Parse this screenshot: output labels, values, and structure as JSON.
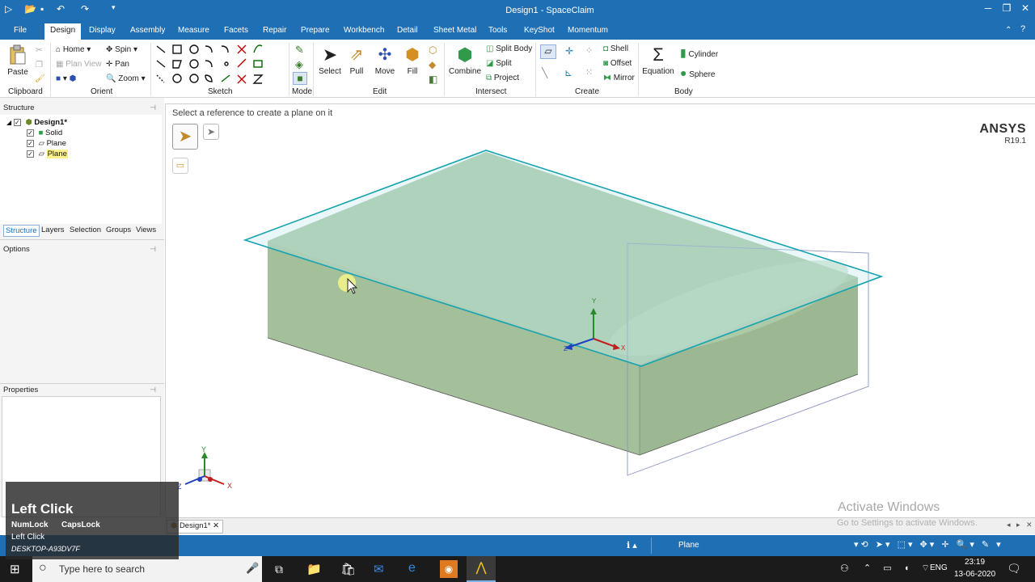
{
  "window": {
    "title": "Design1 - SpaceClaim"
  },
  "tabs": [
    "File",
    "Design",
    "Display",
    "Assembly",
    "Measure",
    "Facets",
    "Repair",
    "Prepare",
    "Workbench",
    "Detail",
    "Sheet Metal",
    "Tools",
    "KeyShot",
    "Momentum"
  ],
  "ribbon": {
    "groups": [
      "Clipboard",
      "Orient",
      "Sketch",
      "Mode",
      "Edit",
      "Intersect",
      "Create",
      "Body"
    ],
    "clipboard": {
      "paste": "Paste"
    },
    "orient": {
      "home": "Home",
      "spin": "Spin",
      "plan_view": "Plan View",
      "pan": "Pan",
      "zoom": "Zoom"
    },
    "edit": {
      "select": "Select",
      "pull": "Pull",
      "move": "Move",
      "fill": "Fill"
    },
    "intersect": {
      "combine": "Combine",
      "split_body": "Split Body",
      "split": "Split",
      "project": "Project"
    },
    "create": {
      "shell": "Shell",
      "offset": "Offset",
      "mirror": "Mirror"
    },
    "body": {
      "equation": "Equation",
      "cylinder": "Cylinder",
      "sphere": "Sphere"
    }
  },
  "structure": {
    "title": "Structure",
    "tree": [
      {
        "label": "Design1*"
      },
      {
        "label": "Solid"
      },
      {
        "label": "Plane"
      },
      {
        "label": "Plane"
      }
    ]
  },
  "panel_tabs": [
    "Structure",
    "Layers",
    "Selection",
    "Groups",
    "Views"
  ],
  "options": {
    "title": "Options"
  },
  "properties": {
    "title": "Properties"
  },
  "viewport": {
    "hint": "Select a reference to create a plane on it",
    "brand": "ANSYS",
    "version": "R19.1",
    "axis_x": "X",
    "axis_y": "Y",
    "axis_z": "Z",
    "watermark_title": "Activate Windows",
    "watermark_sub": "Go to Settings to activate Windows."
  },
  "doc_tab": {
    "label": "Design1*"
  },
  "status": {
    "selection": "Plane"
  },
  "overlay": {
    "action": "Left Click",
    "numlock": "NumLock",
    "capslock": "CapsLock",
    "event": "Left Click",
    "host": "DESKTOP-A93DV7F"
  },
  "taskbar": {
    "search_placeholder": "Type here to search",
    "lang": "ENG",
    "time": "23:19",
    "date": "13-06-2020"
  },
  "colors": {
    "accent": "#1f6fb5",
    "plane_edge": "#17a2b0",
    "solid_fill": "#a4c4a2"
  }
}
